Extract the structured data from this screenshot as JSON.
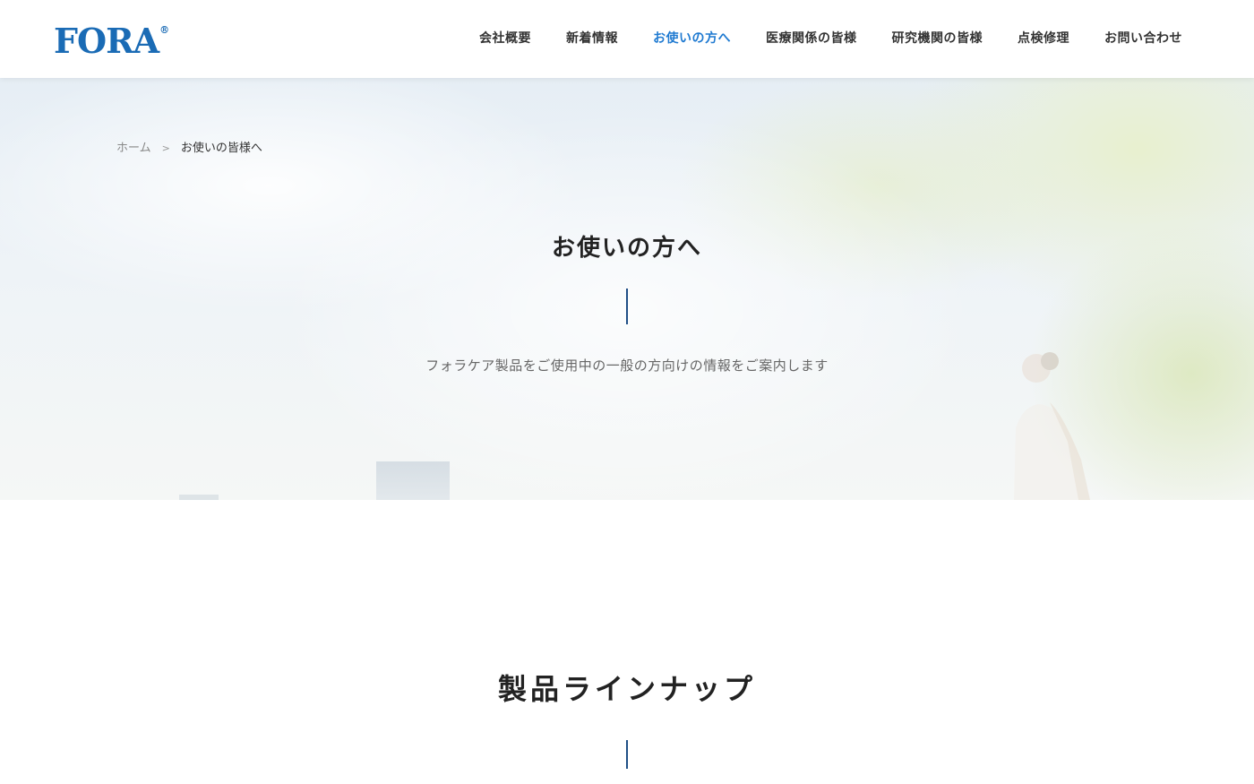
{
  "header": {
    "logo_text": "FORA",
    "logo_mark": "®",
    "nav": [
      {
        "label": "会社概要",
        "active": false
      },
      {
        "label": "新着情報",
        "active": false
      },
      {
        "label": "お使いの方へ",
        "active": true
      },
      {
        "label": "医療関係の皆様",
        "active": false
      },
      {
        "label": "研究機関の皆様",
        "active": false
      },
      {
        "label": "点検修理",
        "active": false
      },
      {
        "label": "お問い合わせ",
        "active": false
      }
    ]
  },
  "breadcrumb": {
    "home": "ホーム",
    "separator": ">",
    "current": "お使いの皆様へ"
  },
  "hero": {
    "title": "お使いの方へ",
    "subtitle": "フォラケア製品をご使用中の一般の方向けの情報をご案内します"
  },
  "lineup": {
    "title": "製品ラインナップ"
  },
  "colors": {
    "brand": "#1a6bb5",
    "nav_active": "#1f7ad1",
    "divider": "#1f4f86"
  }
}
